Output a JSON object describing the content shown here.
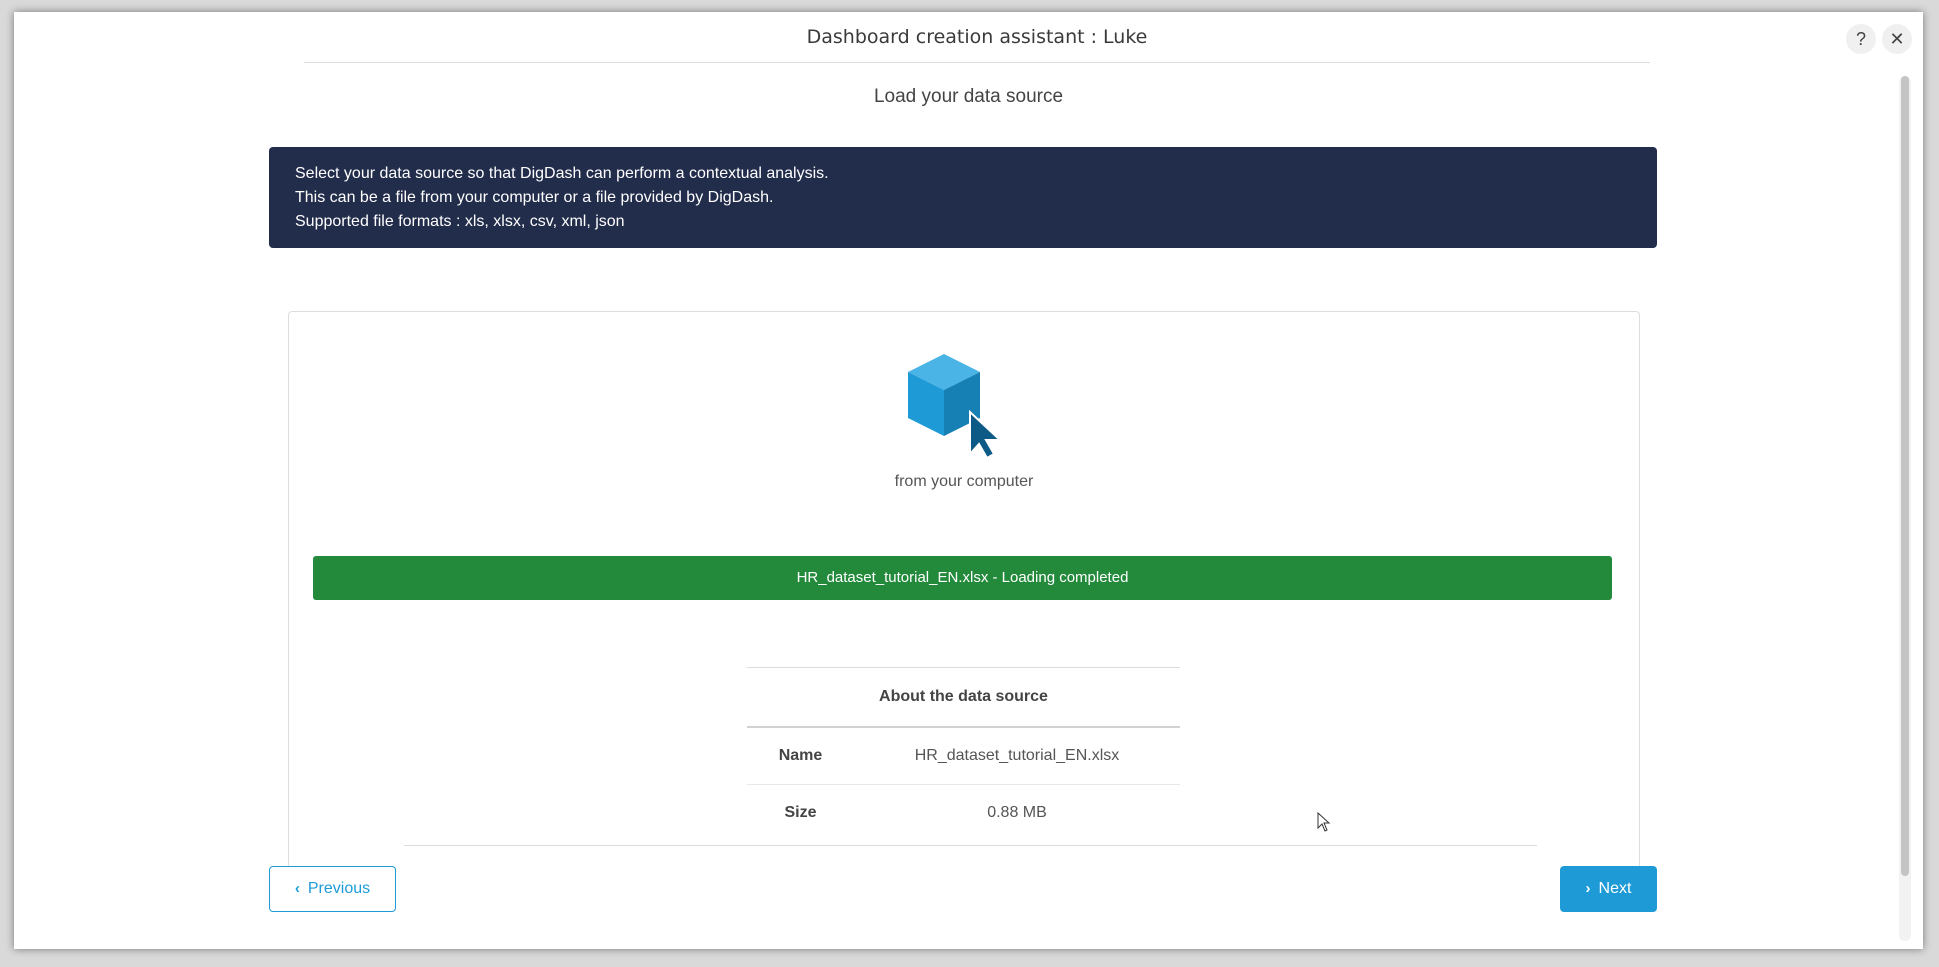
{
  "header": {
    "title": "Dashboard creation assistant : Luke",
    "help_label": "?",
    "close_label": "✕"
  },
  "step": {
    "title": "Load your data source"
  },
  "info_banner": {
    "lines": [
      "Select your data source so that DigDash can perform a contextual analysis.",
      "This can be a file from your computer or a file provided by DigDash.",
      "Supported file formats : xls, xlsx, csv, xml, json"
    ]
  },
  "source_option": {
    "icon": "cube-cursor-icon",
    "label": "from your computer"
  },
  "upload_status": {
    "text": "HR_dataset_tutorial_EN.xlsx - Loading completed",
    "progress": 1.0,
    "color": "#238a3b"
  },
  "about": {
    "title": "About the data source",
    "rows": [
      {
        "key": "Name",
        "value": "HR_dataset_tutorial_EN.xlsx"
      },
      {
        "key": "Size",
        "value": "0.88 MB"
      }
    ]
  },
  "footer": {
    "previous_label": "Previous",
    "next_label": "Next"
  },
  "colors": {
    "accent": "#1e9bd7",
    "banner": "#222c4b",
    "success": "#238a3b"
  }
}
